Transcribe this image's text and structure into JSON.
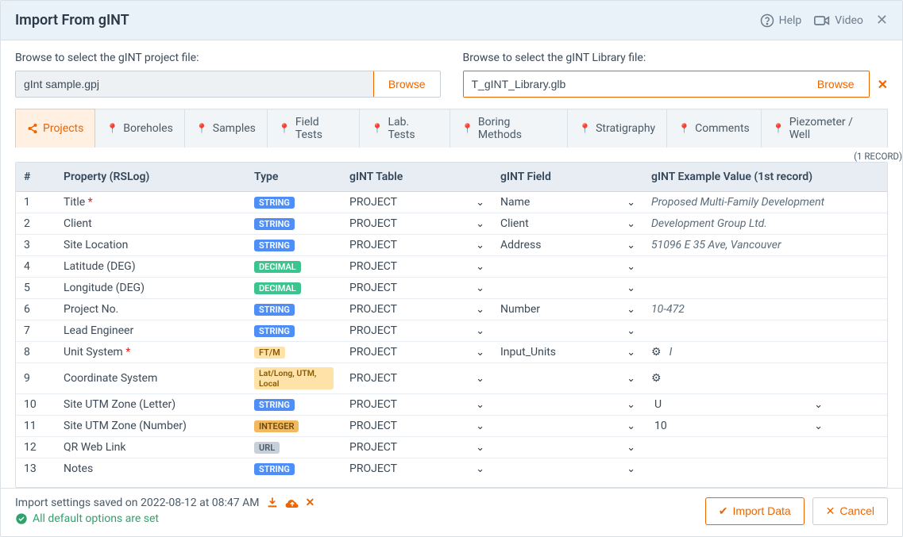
{
  "title": "Import From gINT",
  "help_label": "Help",
  "video_label": "Video",
  "project_file": {
    "label": "Browse to select the gINT project file:",
    "value": "gInt sample.gpj",
    "browse": "Browse"
  },
  "library_file": {
    "label": "Browse to select the gINT Library file:",
    "value": "T_gINT_Library.glb",
    "browse": "Browse"
  },
  "tabs": [
    {
      "label": "Projects"
    },
    {
      "label": "Boreholes"
    },
    {
      "label": "Samples"
    },
    {
      "label": "Field Tests"
    },
    {
      "label": "Lab. Tests"
    },
    {
      "label": "Boring Methods"
    },
    {
      "label": "Stratigraphy"
    },
    {
      "label": "Comments"
    },
    {
      "label": "Piezometer / Well"
    }
  ],
  "record_count": "(1 RECORD)",
  "columns": {
    "num": "#",
    "property": "Property (RSLog)",
    "type": "Type",
    "table": "gINT Table",
    "field": "gINT Field",
    "example": "gINT Example Value (1st record)"
  },
  "rows": [
    {
      "n": "1",
      "prop": "Title",
      "req": true,
      "type": "STRING",
      "type_cls": "badge-string",
      "table": "PROJECT",
      "field": "Name",
      "example": "Proposed Multi-Family Development",
      "style": "italic"
    },
    {
      "n": "2",
      "prop": "Client",
      "req": false,
      "type": "STRING",
      "type_cls": "badge-string",
      "table": "PROJECT",
      "field": "Client",
      "example": "Development Group Ltd.",
      "style": "italic"
    },
    {
      "n": "3",
      "prop": "Site Location",
      "req": false,
      "type": "STRING",
      "type_cls": "badge-string",
      "table": "PROJECT",
      "field": "Address",
      "example": "51096 E 35 Ave, Vancouver",
      "style": "italic"
    },
    {
      "n": "4",
      "prop": "Latitude (DEG)",
      "req": false,
      "type": "DECIMAL",
      "type_cls": "badge-decimal",
      "table": "PROJECT",
      "field": "",
      "example": "",
      "style": ""
    },
    {
      "n": "5",
      "prop": "Longitude (DEG)",
      "req": false,
      "type": "DECIMAL",
      "type_cls": "badge-decimal",
      "table": "PROJECT",
      "field": "",
      "example": "",
      "style": ""
    },
    {
      "n": "6",
      "prop": "Project No.",
      "req": false,
      "type": "STRING",
      "type_cls": "badge-string",
      "table": "PROJECT",
      "field": "Number",
      "example": "10-472",
      "style": "italic"
    },
    {
      "n": "7",
      "prop": "Lead Engineer",
      "req": false,
      "type": "STRING",
      "type_cls": "badge-string",
      "table": "PROJECT",
      "field": "",
      "example": "",
      "style": ""
    },
    {
      "n": "8",
      "prop": "Unit System",
      "req": true,
      "type": "FT/M",
      "type_cls": "badge-ftm",
      "table": "PROJECT",
      "field": "Input_Units",
      "example": "I",
      "style": "gear"
    },
    {
      "n": "9",
      "prop": "Coordinate System",
      "req": false,
      "type": "Lat/Long, UTM, Local",
      "type_cls": "badge-latlong",
      "table": "PROJECT",
      "field": "",
      "example": "",
      "style": "gear"
    },
    {
      "n": "10",
      "prop": "Site UTM Zone (Letter)",
      "req": false,
      "type": "STRING",
      "type_cls": "badge-string",
      "table": "PROJECT",
      "field": "",
      "example": "U",
      "style": "dropdown"
    },
    {
      "n": "11",
      "prop": "Site UTM Zone (Number)",
      "req": false,
      "type": "INTEGER",
      "type_cls": "badge-integer",
      "table": "PROJECT",
      "field": "",
      "example": "10",
      "style": "dropdown"
    },
    {
      "n": "12",
      "prop": "QR Web Link",
      "req": false,
      "type": "URL",
      "type_cls": "badge-url",
      "table": "PROJECT",
      "field": "",
      "example": "",
      "style": ""
    },
    {
      "n": "13",
      "prop": "Notes",
      "req": false,
      "type": "STRING",
      "type_cls": "badge-string",
      "table": "PROJECT",
      "field": "",
      "example": "",
      "style": ""
    }
  ],
  "footer": {
    "saved_text": "Import settings saved on 2022-08-12 at 08:47 AM",
    "defaults_text": "All default options are set",
    "import_btn": "Import Data",
    "cancel_btn": "Cancel"
  }
}
